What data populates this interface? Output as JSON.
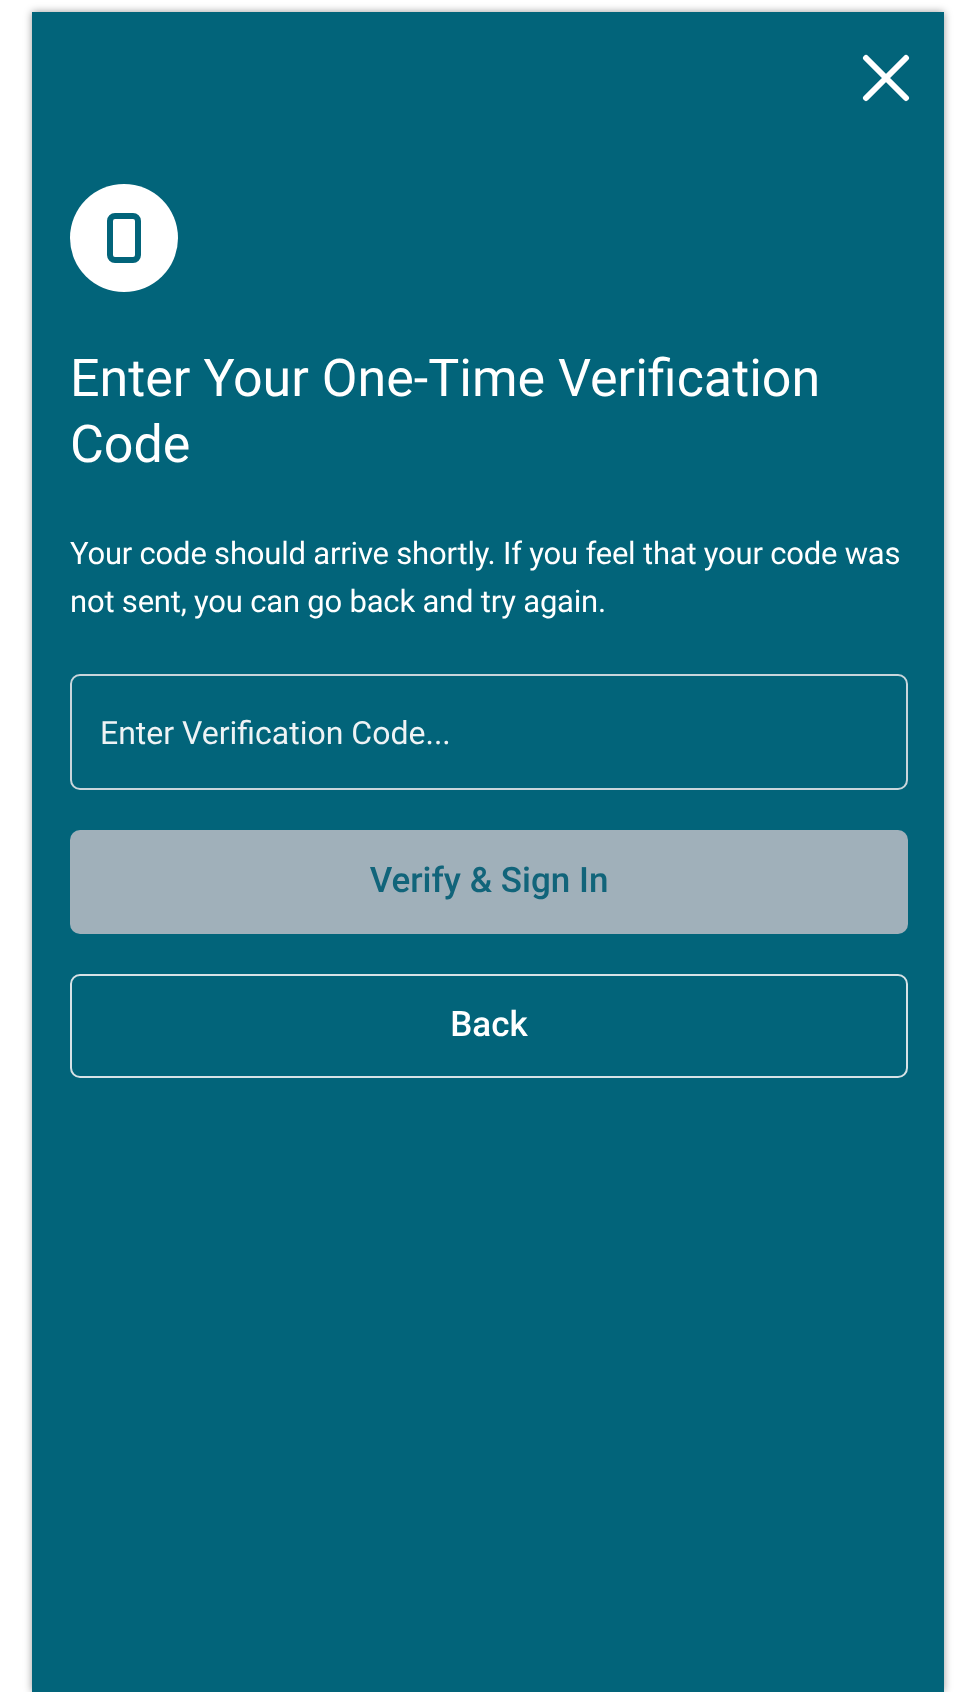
{
  "title": "Enter Your One-Time Verification Code",
  "message": "Your code should arrive shortly. If you feel that your code was not sent, you can go back and try again.",
  "code_field": {
    "placeholder": "Enter Verification Code..."
  },
  "buttons": [
    {
      "label": "Verify & Sign In",
      "kind": "primary",
      "disabled": true
    },
    {
      "label": "Back",
      "kind": "outline",
      "disabled": false
    }
  ]
}
